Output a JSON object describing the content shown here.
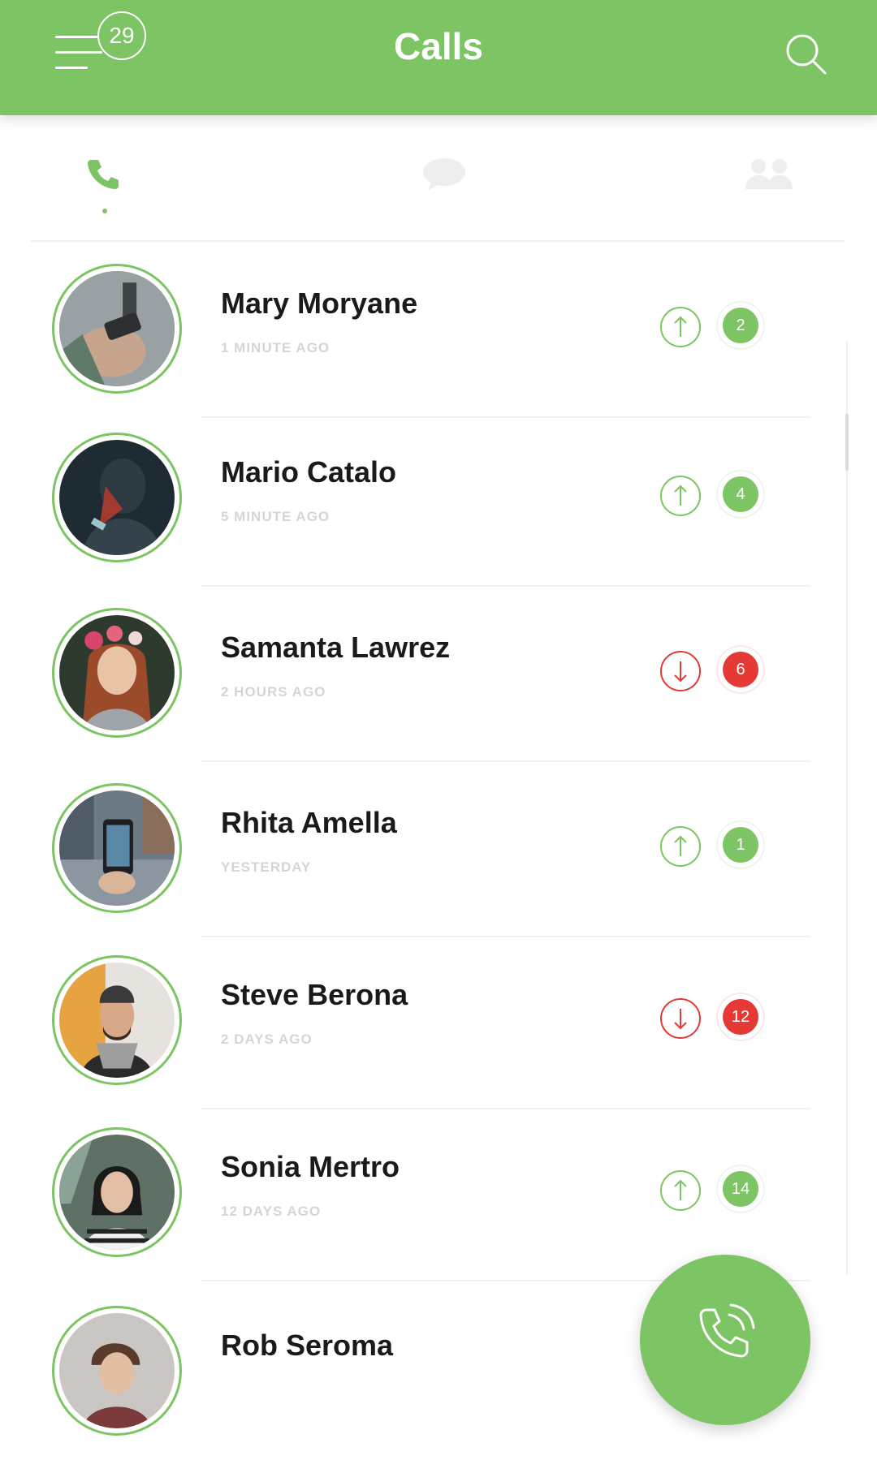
{
  "header": {
    "title": "Calls",
    "notification_count": "29",
    "menu_icon": "hamburger-menu-icon",
    "search_icon": "search-icon"
  },
  "tabs": [
    {
      "name": "calls",
      "icon": "phone-icon",
      "active": true
    },
    {
      "name": "messages",
      "icon": "chat-bubble-icon",
      "active": false
    },
    {
      "name": "contacts",
      "icon": "people-icon",
      "active": false
    }
  ],
  "calls": [
    {
      "name": "Mary Moryane",
      "time": "1 MINUTE AGO",
      "direction": "outgoing",
      "count": "2"
    },
    {
      "name": "Mario Catalo",
      "time": "5 MINUTE AGO",
      "direction": "outgoing",
      "count": "4"
    },
    {
      "name": "Samanta Lawrez",
      "time": "2 HOURS AGO",
      "direction": "incoming",
      "count": "6"
    },
    {
      "name": "Rhita Amella",
      "time": "YESTERDAY",
      "direction": "outgoing",
      "count": "1"
    },
    {
      "name": "Steve Berona",
      "time": "2 DAYS AGO",
      "direction": "incoming",
      "count": "12"
    },
    {
      "name": "Sonia Mertro",
      "time": "12 DAYS AGO",
      "direction": "outgoing",
      "count": "14"
    },
    {
      "name": "Rob Seroma",
      "time": "",
      "direction": "outgoing",
      "count": ""
    }
  ],
  "colors": {
    "brand": "#7cc464",
    "missed": "#e53935",
    "text": "#1a1a1a",
    "muted": "#d5d5d5"
  },
  "fab": {
    "icon": "phone-call-icon"
  }
}
